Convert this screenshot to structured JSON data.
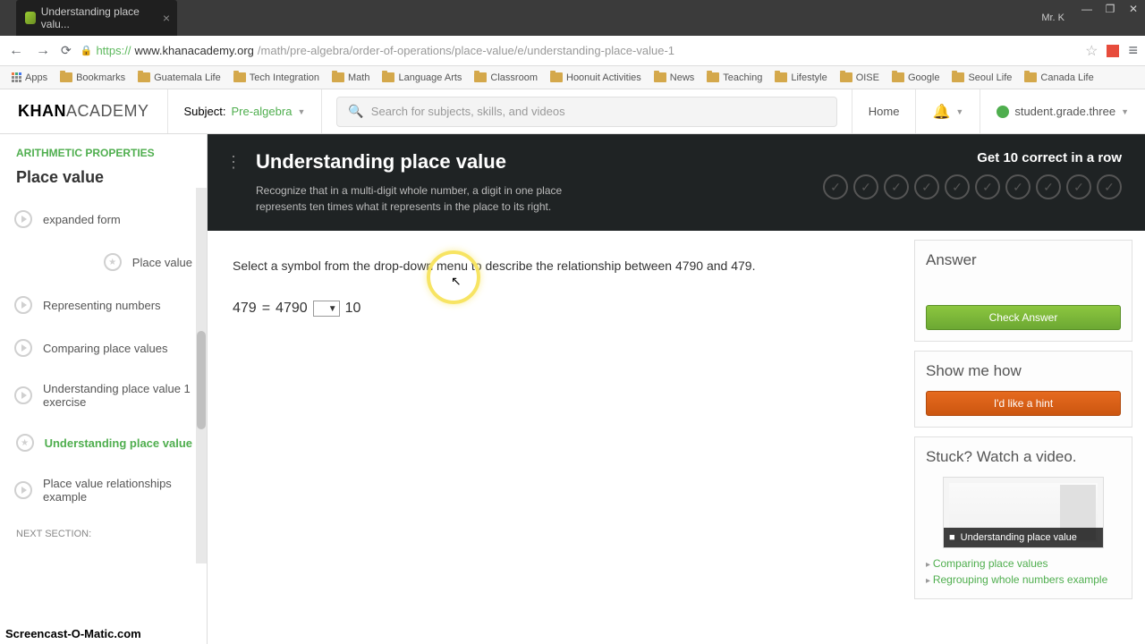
{
  "browser": {
    "tab_title": "Understanding place valu...",
    "user_label": "Mr. K",
    "url_host": "www.khanacademy.org",
    "url_path": "/math/pre-algebra/order-of-operations/place-value/e/understanding-place-value-1",
    "bookmarks": [
      "Apps",
      "Bookmarks",
      "Guatemala Life",
      "Tech Integration",
      "Math",
      "Language Arts",
      "Classroom",
      "Hoonuit Activities",
      "News",
      "Teaching",
      "Lifestyle",
      "OISE",
      "Google",
      "Seoul Life",
      "Canada Life"
    ]
  },
  "ka_header": {
    "logo_a": "KHAN",
    "logo_b": "ACADEMY",
    "subject_label": "Subject:",
    "subject_value": "Pre-algebra",
    "search_placeholder": "Search for subjects, skills, and videos",
    "home": "Home",
    "username": "student.grade.three"
  },
  "sidebar": {
    "category": "ARITHMETIC PROPERTIES",
    "section_title": "Place value",
    "items": [
      {
        "label": "expanded form",
        "icon": "play"
      },
      {
        "label": "Place value",
        "icon": "star"
      },
      {
        "label": "Representing numbers",
        "icon": "play"
      },
      {
        "label": "Comparing place values",
        "icon": "play"
      },
      {
        "label": "Understanding place value 1 exercise",
        "icon": "play"
      },
      {
        "label": "Understanding place value",
        "icon": "star",
        "active": true
      },
      {
        "label": "Place value relationships example",
        "icon": "play"
      }
    ],
    "next_section": "NEXT SECTION:"
  },
  "exercise": {
    "title": "Understanding place value",
    "subtitle": "Recognize that in a multi-digit whole number, a digit in one place represents ten times what it represents in the place to its right.",
    "goal": "Get 10 correct in a row",
    "prompt_a": "Select a symbol from the drop-down menu to describe the relationship between ",
    "num1": "4790",
    "prompt_b": " and ",
    "num2": "479",
    "prompt_c": ".",
    "eq": {
      "lhs": "479",
      "eq": "=",
      "mid": "4790",
      "rhs": "10"
    }
  },
  "panels": {
    "answer_title": "Answer",
    "check_btn": "Check Answer",
    "how_title": "Show me how",
    "hint_btn": "I'd like a hint",
    "stuck_title": "Stuck? Watch a video.",
    "video_label": "Understanding place value",
    "links": [
      "Comparing place values",
      "Regrouping whole numbers example"
    ]
  },
  "watermark": "Screencast-O-Matic.com"
}
